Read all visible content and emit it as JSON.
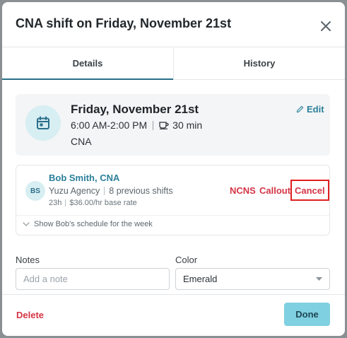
{
  "dialog": {
    "title": "CNA shift on Friday, November 21st"
  },
  "tabs": [
    {
      "label": "Details",
      "active": true
    },
    {
      "label": "History",
      "active": false
    }
  ],
  "shift": {
    "date": "Friday, November 21st",
    "time": "6:00 AM-2:00 PM",
    "break": "30 min",
    "role": "CNA",
    "edit_label": "Edit",
    "icon": "calendar-icon"
  },
  "worker": {
    "initials": "BS",
    "name": "Bob Smith, CNA",
    "agency": "Yuzu Agency",
    "previous_shifts": "8 previous shifts",
    "hours": "23h",
    "rate": "$36.00/hr base rate",
    "actions": {
      "ncns": "NCNS",
      "callout": "Callout",
      "cancel": "Cancel"
    },
    "schedule_toggle": "Show Bob's schedule for the week"
  },
  "form": {
    "notes_label": "Notes",
    "notes_placeholder": "Add a note",
    "color_label": "Color",
    "color_value": "Emerald"
  },
  "footer": {
    "delete_label": "Delete",
    "done_label": "Done"
  },
  "colors": {
    "accent": "#2a7f9a",
    "danger": "#d43545",
    "done_button": "#7fd0e0"
  }
}
